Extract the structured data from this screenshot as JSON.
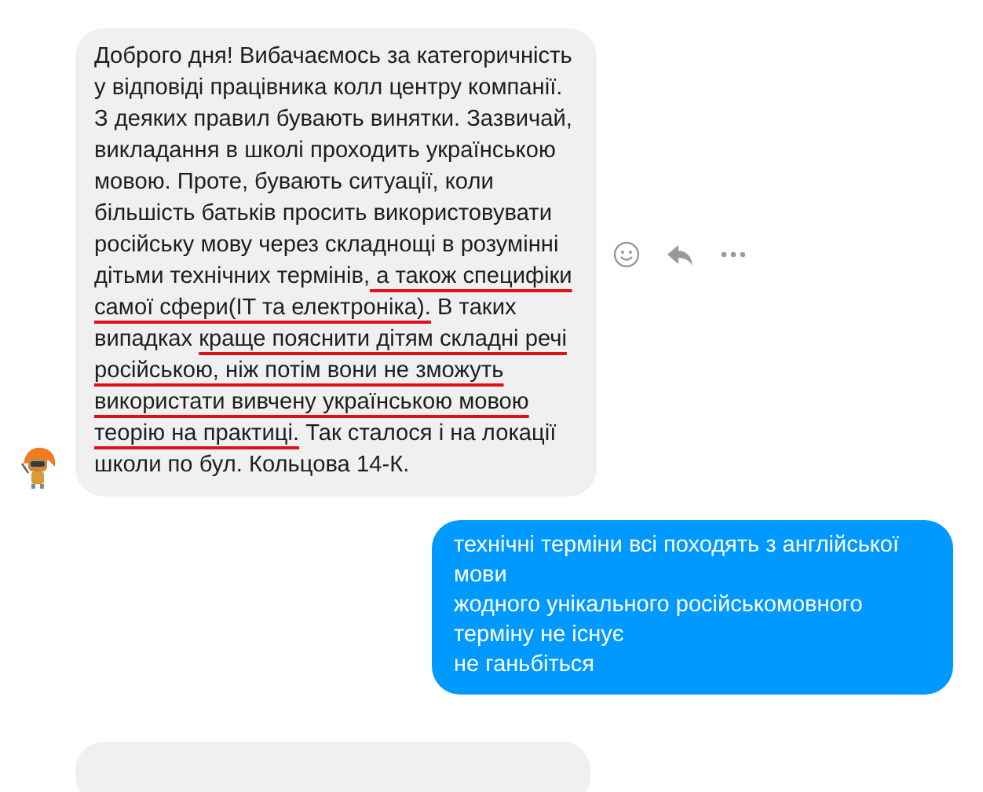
{
  "messages": [
    {
      "kind": "incoming",
      "segments": [
        {
          "text": "Доброго дня! Вибачаємось за категоричність у відповіді працівника колл центру компанії. З деяких правил бувають винятки. Зазвичай, викладання в школі проходить українською мовою. Проте, бувають ситуації, коли більшість батьків просить використовувати російську мову через складнощі в розумінні дітьми технічних термінів,",
          "underlined": false
        },
        {
          "text": " а також специфіки самої сфери(IT та електроніка).",
          "underlined": true
        },
        {
          "text": " В таких випадках ",
          "underlined": false
        },
        {
          "text": "краще пояснити дітям складні речі російською, ніж потім вони не зможуть використати вивчену українською мовою теорію на практиці.",
          "underlined": true
        },
        {
          "text": " Так сталося і на локації школи по бул. Кольцова 14-К.",
          "underlined": false
        }
      ]
    },
    {
      "kind": "outgoing",
      "lines": [
        "технічні терміни всі походять з англійської мови",
        "жодного унікального російськомовного терміну не існує",
        "не ганьбіться"
      ]
    },
    {
      "kind": "incoming-partial"
    }
  ]
}
